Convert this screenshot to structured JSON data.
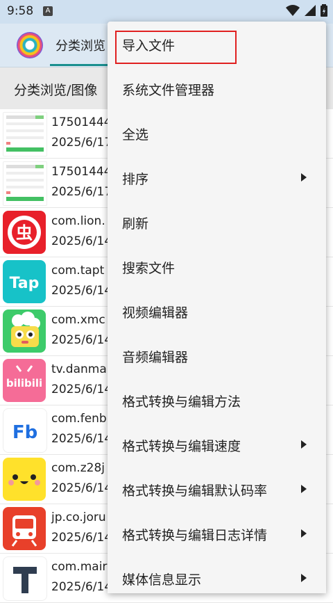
{
  "status_bar": {
    "time": "9:58",
    "notification_icon": "a-icon"
  },
  "app_bar": {
    "tab_label": "分类浏览"
  },
  "path_bar": {
    "path": "分类浏览/图像"
  },
  "files": [
    {
      "name": "17501444",
      "date": "2025/6/17",
      "thumb": "screenshot-thumb"
    },
    {
      "name": "17501444",
      "date": "2025/6/17",
      "thumb": "screenshot-thumb"
    },
    {
      "name": "com.lion.",
      "date": "2025/6/14",
      "thumb": "chong-app-icon"
    },
    {
      "name": "com.tapt",
      "date": "2025/6/14",
      "thumb": "taptap-app-icon"
    },
    {
      "name": "com.xmc",
      "date": "2025/6/14",
      "thumb": "popcorn-app-icon"
    },
    {
      "name": "tv.danma",
      "date": "2025/6/14",
      "thumb": "bilibili-app-icon"
    },
    {
      "name": "com.fenb",
      "date": "2025/6/14",
      "thumb": "fenbi-app-icon"
    },
    {
      "name": "com.z28j",
      "date": "2025/6/14",
      "thumb": "smiley-app-icon"
    },
    {
      "name": "jp.co.joru",
      "date": "2025/6/14",
      "thumb": "train-app-icon"
    },
    {
      "name": "com.mair",
      "date": "2025/6/14",
      "thumb": "t-app-icon"
    }
  ],
  "thumb_labels": {
    "tap": "Tap",
    "bilibili": "bilibili",
    "fb": "Fb",
    "chong": "虫"
  },
  "menu": {
    "items": [
      {
        "label": "导入文件",
        "submenu": false,
        "highlighted": true
      },
      {
        "label": "系统文件管理器",
        "submenu": false
      },
      {
        "label": "全选",
        "submenu": false
      },
      {
        "label": "排序",
        "submenu": true
      },
      {
        "label": "刷新",
        "submenu": false
      },
      {
        "label": "搜索文件",
        "submenu": false
      },
      {
        "label": "视频编辑器",
        "submenu": false
      },
      {
        "label": "音频编辑器",
        "submenu": false
      },
      {
        "label": "格式转换与编辑方法",
        "submenu": false
      },
      {
        "label": "格式转换与编辑速度",
        "submenu": true
      },
      {
        "label": "格式转换与编辑默认码率",
        "submenu": true
      },
      {
        "label": "格式转换与编辑日志详情",
        "submenu": true
      },
      {
        "label": "媒体信息显示",
        "submenu": true
      }
    ]
  },
  "colors": {
    "accent": "#1a8f8f",
    "highlight_border": "#e02020"
  }
}
